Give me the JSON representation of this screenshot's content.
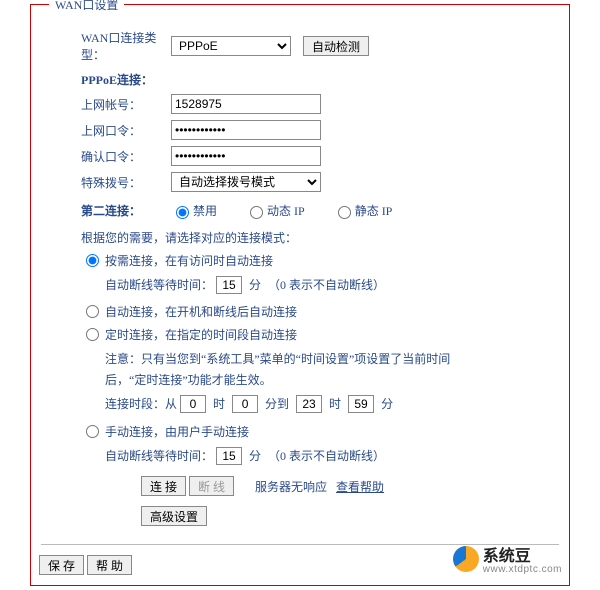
{
  "panel_title": "WAN口设置",
  "labels": {
    "wan_type": "WAN口连接类型：",
    "pppoe_header": "PPPoE连接：",
    "account": "上网帐号：",
    "password": "上网口令：",
    "confirm": "确认口令：",
    "special_dial": "特殊拨号：",
    "second_conn": "第二连接："
  },
  "wan_type_value": "PPPoE",
  "auto_detect": "自动检测",
  "account_value": "1528975",
  "password_value": "••••••••••••",
  "confirm_value": "••••••••••••",
  "special_dial_value": "自动选择拨号模式",
  "second_conn_options": {
    "disable": "禁用",
    "dynamic": "动态 IP",
    "static": "静态 IP"
  },
  "mode_prompt": "根据您的需要，请选择对应的连接模式：",
  "modes": {
    "on_demand": "按需连接，在有访问时自动连接",
    "auto": "自动连接，在开机和断线后自动连接",
    "scheduled": "定时连接，在指定的时间段自动连接",
    "manual": "手动连接，由用户手动连接"
  },
  "idle_line": {
    "prefix": "自动断线等待时间：",
    "value": "15",
    "suffix1": "分",
    "suffix2": "（0 表示不自动断线）"
  },
  "scheduled_note": "注意：只有当您到“系统工具”菜单的“时间设置”项设置了当前时间后，“定时连接”功能才能生效。",
  "scheduled_time": {
    "prefix": "连接时段：从",
    "h1": "0",
    "m1": "0",
    "mid": "分到",
    "h2": "23",
    "m2": "59",
    "end": "分",
    "hour": "时"
  },
  "buttons": {
    "connect": "连 接",
    "disconnect": "断 线",
    "advanced": "高级设置",
    "save": "保 存",
    "help": "帮 助"
  },
  "server_status": "服务器无响应",
  "help_link": "查看帮助",
  "watermark": {
    "name": "系统豆",
    "url": "www.xtdptc.com"
  }
}
